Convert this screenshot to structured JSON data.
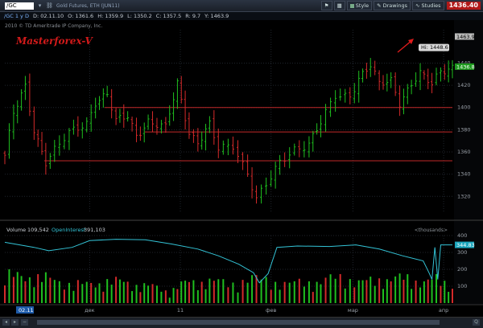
{
  "toolbar": {
    "symbol": "/GC",
    "instrument": "Gold Futures, ETH (JUN11)",
    "style_label": "Style",
    "drawings_label": "Drawings",
    "studies_label": "Studies",
    "last_price": "1436.40"
  },
  "infobar": {
    "aggregation": "/GC 1 y D",
    "date": "D: 02.11.10",
    "open": "O: 1361.6",
    "high": "H: 1359.9",
    "low": "L: 1350.2",
    "close": "C: 1357.5",
    "range": "R: 9.7",
    "y": "Y: 1463.9"
  },
  "scrollbar": {
    "zoom": "Q"
  },
  "colors": {
    "up": "#1fbf1f",
    "down": "#d42a2a",
    "support": "#c12828",
    "oi": "#33c3d6",
    "price_tag": "#1f9a1f",
    "oi_tag": "#1aa6bd"
  },
  "chart_data": {
    "type": "candlestick",
    "copyright": "2010 © TD Ameritrade IP Company, Inc.",
    "watermark": "Masterforex-V",
    "price_axis": {
      "range": [
        1305,
        1470
      ],
      "ticks": [
        1320,
        1340,
        1360,
        1380,
        1400,
        1420,
        1440
      ]
    },
    "x_labels": [
      "дек",
      "11",
      "фев",
      "мар",
      "апр"
    ],
    "x_label_dates": [
      "2010-12-01",
      "2011-01-01",
      "2011-02-01",
      "2011-03-01",
      "2011-04-01"
    ],
    "date_range": [
      "2010-11-02",
      "2011-04-04"
    ],
    "cursor_date": "02.11",
    "high_tag": "Hi: 1448.6",
    "last_price_tag": "1436.8",
    "top_tag": "1463.9",
    "support_lines": [
      1400,
      1378,
      1352
    ],
    "close_series": [
      {
        "d": "2010-11-02",
        "c": 1357
      },
      {
        "d": "2010-11-05",
        "c": 1394
      },
      {
        "d": "2010-11-09",
        "c": 1418
      },
      {
        "d": "2010-11-12",
        "c": 1380
      },
      {
        "d": "2010-11-16",
        "c": 1352
      },
      {
        "d": "2010-11-19",
        "c": 1362
      },
      {
        "d": "2010-11-24",
        "c": 1376
      },
      {
        "d": "2010-11-30",
        "c": 1386
      },
      {
        "d": "2010-12-03",
        "c": 1406
      },
      {
        "d": "2010-12-07",
        "c": 1412
      },
      {
        "d": "2010-12-10",
        "c": 1387
      },
      {
        "d": "2010-12-14",
        "c": 1392
      },
      {
        "d": "2010-12-17",
        "c": 1375
      },
      {
        "d": "2010-12-21",
        "c": 1388
      },
      {
        "d": "2010-12-27",
        "c": 1381
      },
      {
        "d": "2010-12-31",
        "c": 1421
      },
      {
        "d": "2011-01-04",
        "c": 1378
      },
      {
        "d": "2011-01-07",
        "c": 1369
      },
      {
        "d": "2011-01-11",
        "c": 1384
      },
      {
        "d": "2011-01-14",
        "c": 1362
      },
      {
        "d": "2011-01-19",
        "c": 1366
      },
      {
        "d": "2011-01-24",
        "c": 1342
      },
      {
        "d": "2011-01-27",
        "c": 1318
      },
      {
        "d": "2011-02-01",
        "c": 1336
      },
      {
        "d": "2011-02-04",
        "c": 1350
      },
      {
        "d": "2011-02-09",
        "c": 1363
      },
      {
        "d": "2011-02-14",
        "c": 1368
      },
      {
        "d": "2011-02-18",
        "c": 1386
      },
      {
        "d": "2011-02-23",
        "c": 1410
      },
      {
        "d": "2011-02-28",
        "c": 1411
      },
      {
        "d": "2011-03-03",
        "c": 1427
      },
      {
        "d": "2011-03-07",
        "c": 1438
      },
      {
        "d": "2011-03-10",
        "c": 1420
      },
      {
        "d": "2011-03-14",
        "c": 1424
      },
      {
        "d": "2011-03-17",
        "c": 1405
      },
      {
        "d": "2011-03-21",
        "c": 1422
      },
      {
        "d": "2011-03-24",
        "c": 1430
      },
      {
        "d": "2011-03-28",
        "c": 1420
      },
      {
        "d": "2011-03-31",
        "c": 1433
      },
      {
        "d": "2011-04-04",
        "c": 1437
      }
    ],
    "volume_axis": {
      "range": [
        0,
        400
      ],
      "ticks": [
        100,
        200,
        300,
        400
      ]
    },
    "volume_legend": {
      "volume_label": "Volume",
      "volume_value": "109,542",
      "oi_label": "OpenInterest",
      "oi_value": "391,103",
      "units": "<thousands>"
    },
    "oi_last_tag": "344.83",
    "volume_series": [
      {
        "d": "2010-11-02",
        "v": 190
      },
      {
        "d": "2010-11-09",
        "v": 180
      },
      {
        "d": "2010-11-16",
        "v": 170
      },
      {
        "d": "2010-11-23",
        "v": 140
      },
      {
        "d": "2010-11-30",
        "v": 120
      },
      {
        "d": "2010-12-07",
        "v": 150
      },
      {
        "d": "2010-12-14",
        "v": 140
      },
      {
        "d": "2010-12-21",
        "v": 110
      },
      {
        "d": "2010-12-28",
        "v": 90
      },
      {
        "d": "2011-01-04",
        "v": 140
      },
      {
        "d": "2011-01-11",
        "v": 150
      },
      {
        "d": "2011-01-18",
        "v": 130
      },
      {
        "d": "2011-01-25",
        "v": 170
      },
      {
        "d": "2011-02-01",
        "v": 150
      },
      {
        "d": "2011-02-08",
        "v": 130
      },
      {
        "d": "2011-02-15",
        "v": 140
      },
      {
        "d": "2011-02-22",
        "v": 170
      },
      {
        "d": "2011-03-01",
        "v": 160
      },
      {
        "d": "2011-03-08",
        "v": 140
      },
      {
        "d": "2011-03-15",
        "v": 180
      },
      {
        "d": "2011-03-22",
        "v": 150
      },
      {
        "d": "2011-03-29",
        "v": 160
      },
      {
        "d": "2011-04-04",
        "v": 110
      }
    ],
    "oi_series": [
      {
        "d": "2010-11-02",
        "v": 360
      },
      {
        "d": "2010-11-12",
        "v": 330
      },
      {
        "d": "2010-11-17",
        "v": 310
      },
      {
        "d": "2010-11-25",
        "v": 330
      },
      {
        "d": "2010-12-01",
        "v": 370
      },
      {
        "d": "2010-12-10",
        "v": 378
      },
      {
        "d": "2010-12-20",
        "v": 375
      },
      {
        "d": "2010-12-29",
        "v": 350
      },
      {
        "d": "2011-01-07",
        "v": 320
      },
      {
        "d": "2011-01-14",
        "v": 280
      },
      {
        "d": "2011-01-21",
        "v": 230
      },
      {
        "d": "2011-01-26",
        "v": 180
      },
      {
        "d": "2011-01-28",
        "v": 120
      },
      {
        "d": "2011-01-31",
        "v": 175
      },
      {
        "d": "2011-02-03",
        "v": 330
      },
      {
        "d": "2011-02-10",
        "v": 338
      },
      {
        "d": "2011-02-21",
        "v": 335
      },
      {
        "d": "2011-03-02",
        "v": 345
      },
      {
        "d": "2011-03-10",
        "v": 320
      },
      {
        "d": "2011-03-18",
        "v": 280
      },
      {
        "d": "2011-03-25",
        "v": 250
      },
      {
        "d": "2011-03-27",
        "v": 180
      },
      {
        "d": "2011-03-28",
        "v": 140
      },
      {
        "d": "2011-03-29",
        "v": 330
      },
      {
        "d": "2011-03-30",
        "v": 140
      },
      {
        "d": "2011-03-31",
        "v": 345
      },
      {
        "d": "2011-04-04",
        "v": 344.83
      }
    ]
  }
}
